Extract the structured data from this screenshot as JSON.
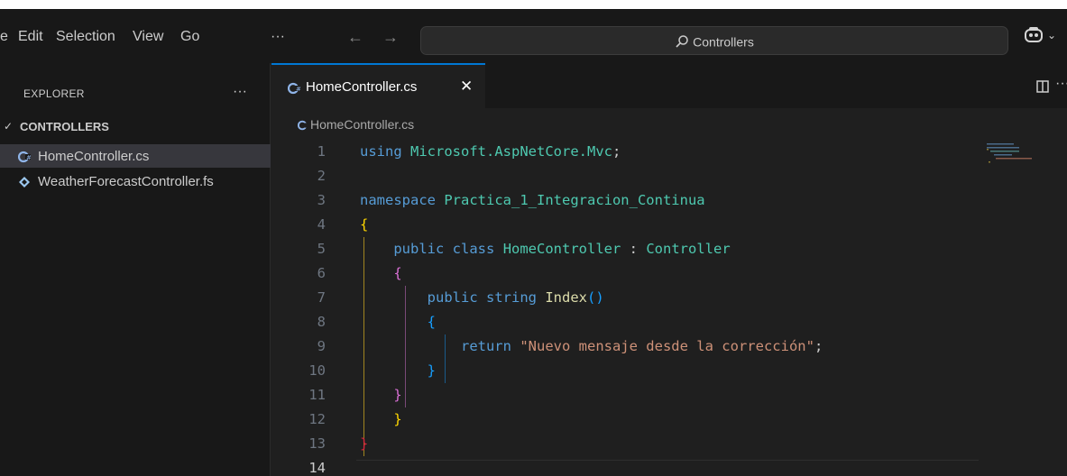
{
  "menu": {
    "file_partial": "e",
    "edit": "Edit",
    "selection": "Selection",
    "view": "View",
    "go": "Go",
    "more": "···"
  },
  "command_center": {
    "label": "Controllers",
    "icon": "search-icon"
  },
  "sidebar": {
    "title": "EXPLORER",
    "more": "···",
    "folder": "CONTROLLERS",
    "files": [
      {
        "name": "HomeController.cs",
        "icon": "csharp-icon",
        "selected": true
      },
      {
        "name": "WeatherForecastController.fs",
        "icon": "fsharp-icon",
        "selected": false
      }
    ]
  },
  "tabs": [
    {
      "label": "HomeController.cs",
      "close": "✕"
    }
  ],
  "editor_actions": {
    "more": "···"
  },
  "breadcrumb": {
    "file": "HomeController.cs"
  },
  "code": {
    "line_numbers": [
      "1",
      "2",
      "3",
      "4",
      "5",
      "6",
      "7",
      "8",
      "9",
      "10",
      "11",
      "12",
      "13",
      "14"
    ],
    "active_line": "14",
    "l1": {
      "kw": "using",
      "ns": "Microsoft.AspNetCore.Mvc",
      "semi": ";"
    },
    "l3": {
      "kw": "namespace",
      "ns": "Practica_1_Integracion_Continua"
    },
    "l4": "{",
    "l5": {
      "kw1": "public",
      "kw2": "class",
      "name": "HomeController",
      "colon": " : ",
      "base": "Controller"
    },
    "l6": "{",
    "l7": {
      "kw1": "public",
      "kw2": "string",
      "fn": "Index",
      "parens": "()"
    },
    "l8": "{",
    "l9": {
      "kw": "return",
      "str": "\"Nuevo mensaje desde la corrección\"",
      "semi": ";"
    },
    "l10": "}",
    "l11": "}",
    "l12": "}",
    "l13": "}"
  },
  "colors": {
    "accent": "#0078d4",
    "keyword": "#569cd6",
    "type": "#4ec9b0",
    "function": "#dcdcaa",
    "string": "#ce9178"
  }
}
